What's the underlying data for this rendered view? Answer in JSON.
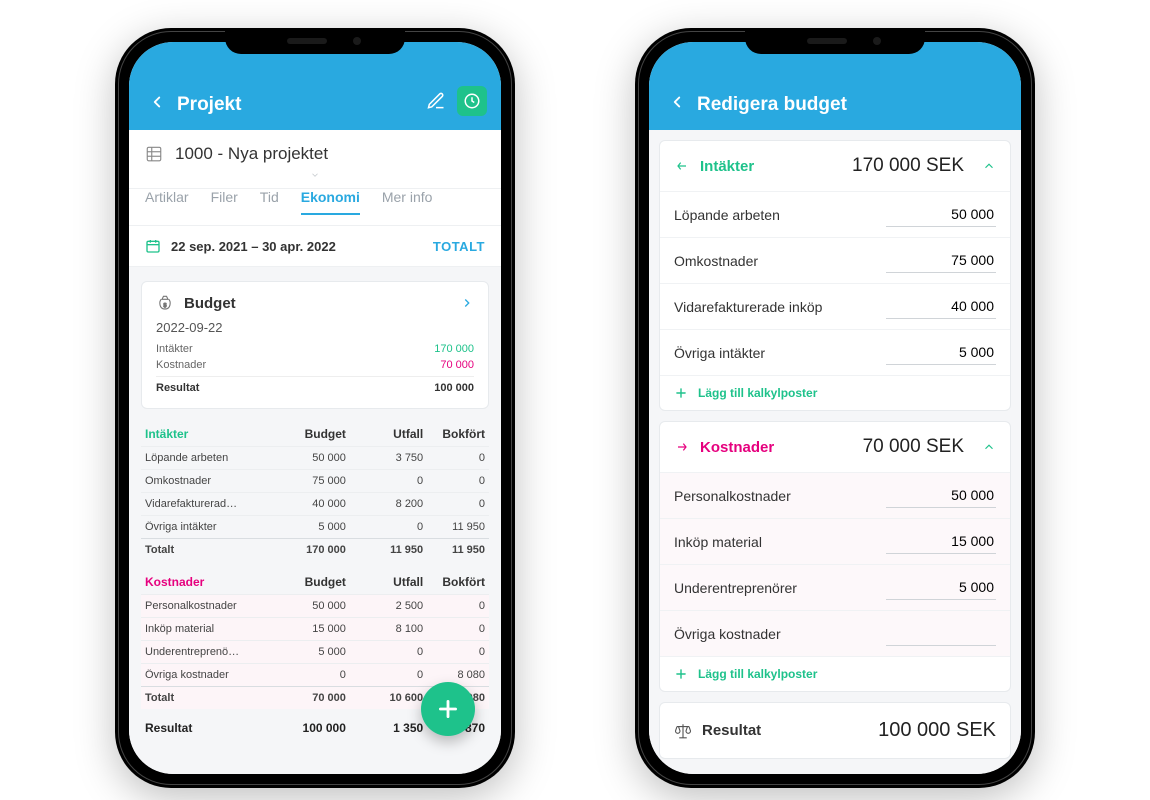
{
  "colors": {
    "brand": "#29a9e0",
    "accent": "#1ec28b",
    "magenta": "#e6007e"
  },
  "phone1": {
    "header": {
      "title": "Projekt"
    },
    "project": {
      "name": "1000 - Nya projektet"
    },
    "tabs": [
      {
        "label": "Artiklar",
        "active": false
      },
      {
        "label": "Filer",
        "active": false
      },
      {
        "label": "Tid",
        "active": false
      },
      {
        "label": "Ekonomi",
        "active": true
      },
      {
        "label": "Mer info",
        "active": false
      }
    ],
    "period": {
      "range": "22 sep. 2021 – 30 apr. 2022",
      "totalt": "TOTALT"
    },
    "budgetCard": {
      "title": "Budget",
      "date": "2022-09-22",
      "intakter_label": "Intäkter",
      "intakter_value": "170 000",
      "kostnader_label": "Kostnader",
      "kostnader_value": "70 000",
      "resultat_label": "Resultat",
      "resultat_value": "100 000"
    },
    "incomeTable": {
      "header": {
        "cat": "Intäkter",
        "c1": "Budget",
        "c2": "Utfall",
        "c3": "Bokfört"
      },
      "rows": [
        {
          "label": "Löpande arbeten",
          "budget": "50 000",
          "utfall": "3 750",
          "bokfort": "0"
        },
        {
          "label": "Omkostnader",
          "budget": "75 000",
          "utfall": "0",
          "bokfort": "0"
        },
        {
          "label": "Vidarefakturerad…",
          "budget": "40 000",
          "utfall": "8 200",
          "bokfort": "0"
        },
        {
          "label": "Övriga intäkter",
          "budget": "5 000",
          "utfall": "0",
          "bokfort": "11 950"
        }
      ],
      "total": {
        "label": "Totalt",
        "budget": "170 000",
        "utfall": "11 950",
        "bokfort": "11 950"
      }
    },
    "costTable": {
      "header": {
        "cat": "Kostnader",
        "c1": "Budget",
        "c2": "Utfall",
        "c3": "Bokfört"
      },
      "rows": [
        {
          "label": "Personalkostnader",
          "budget": "50 000",
          "utfall": "2 500",
          "bokfort": "0"
        },
        {
          "label": "Inköp material",
          "budget": "15 000",
          "utfall": "8 100",
          "bokfort": "0"
        },
        {
          "label": "Underentreprenö…",
          "budget": "5 000",
          "utfall": "0",
          "bokfort": "0"
        },
        {
          "label": "Övriga kostnader",
          "budget": "0",
          "utfall": "0",
          "bokfort": "8 080"
        }
      ],
      "total": {
        "label": "Totalt",
        "budget": "70 000",
        "utfall": "10 600",
        "bokfort": "8 080"
      }
    },
    "result": {
      "label": "Resultat",
      "budget": "100 000",
      "utfall": "1 350",
      "bokfort": "3 870"
    }
  },
  "phone2": {
    "header": {
      "title": "Redigera budget"
    },
    "income": {
      "label": "Intäkter",
      "total": "170 000 SEK",
      "rows": [
        {
          "label": "Löpande arbeten",
          "value": "50 000"
        },
        {
          "label": "Omkostnader",
          "value": "75 000"
        },
        {
          "label": "Vidarefakturerade inköp",
          "value": "40 000"
        },
        {
          "label": "Övriga intäkter",
          "value": "5 000"
        }
      ],
      "add": "Lägg till kalkylposter"
    },
    "cost": {
      "label": "Kostnader",
      "total": "70 000 SEK",
      "rows": [
        {
          "label": "Personalkostnader",
          "value": "50 000"
        },
        {
          "label": "Inköp material",
          "value": "15 000"
        },
        {
          "label": "Underentreprenörer",
          "value": "5 000"
        },
        {
          "label": "Övriga kostnader",
          "value": ""
        }
      ],
      "add": "Lägg till kalkylposter"
    },
    "result": {
      "label": "Resultat",
      "value": "100 000 SEK"
    }
  }
}
